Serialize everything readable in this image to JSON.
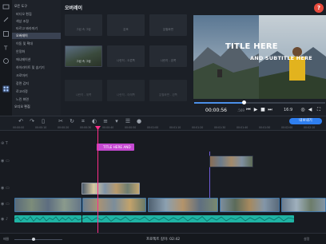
{
  "sidebar": {
    "header": "모든 도구",
    "items": [
      {
        "label": "비디오 편집"
      },
      {
        "label": "색상 조정"
      },
      {
        "label": "타르고 봐라마기"
      },
      {
        "label": "오버레이"
      },
      {
        "label": "이동 및 확대"
      },
      {
        "label": "안정화"
      },
      {
        "label": "애니메이션"
      },
      {
        "label": "하이라이트 및 숨기기"
      },
      {
        "label": "크로마키"
      },
      {
        "label": "장면 감지"
      },
      {
        "label": "로고리정"
      },
      {
        "label": "느린 화면"
      }
    ],
    "footer": "오디오 편집"
  },
  "overlay_panel": {
    "title": "오버레이",
    "thumbs": [
      {
        "label": "그림 속 그림"
      },
      {
        "label": "분포"
      },
      {
        "label": "분할화면"
      },
      {
        "label": "그림 속 그림"
      },
      {
        "label": "나란히 - 오른쪽"
      },
      {
        "label": "나란히 - 왼쪽"
      },
      {
        "label": "나란히 - 위쪽"
      },
      {
        "label": "나란히 - 아래쪽"
      },
      {
        "label": "분할화면 - 왼쪽"
      }
    ]
  },
  "preview": {
    "title_text": "TITLE HERE",
    "subtitle_text": "AND SUBTITLE HERE",
    "current_time": "00:00:56",
    "current_time_ms": ".569",
    "aspect": "16:9",
    "help_label": "?",
    "progress": 0.38
  },
  "toolbar": {
    "export_label": "내보내기"
  },
  "ruler": {
    "labels": [
      "00:00:00",
      "00:00:10",
      "00:00:20",
      "00:00:30",
      "00:00:40",
      "00:00:50",
      "00:01:00",
      "00:01:10",
      "00:01:20",
      "00:01:30",
      "00:01:40",
      "00:01:50",
      "00:02:00",
      "00:02:10"
    ]
  },
  "timeline": {
    "title_clip_label": "TITLE HERE AND"
  },
  "bottom": {
    "zoom_label": "배율",
    "duration_label": "프로젝트 길이: 02:42",
    "settings_label": "설정"
  },
  "colors": {
    "accent": "#2f7ff0",
    "playhead": "#ff2e8a",
    "title_clip": "#c548d2",
    "audio": "#1fb4a4",
    "help": "#e64a3c"
  }
}
